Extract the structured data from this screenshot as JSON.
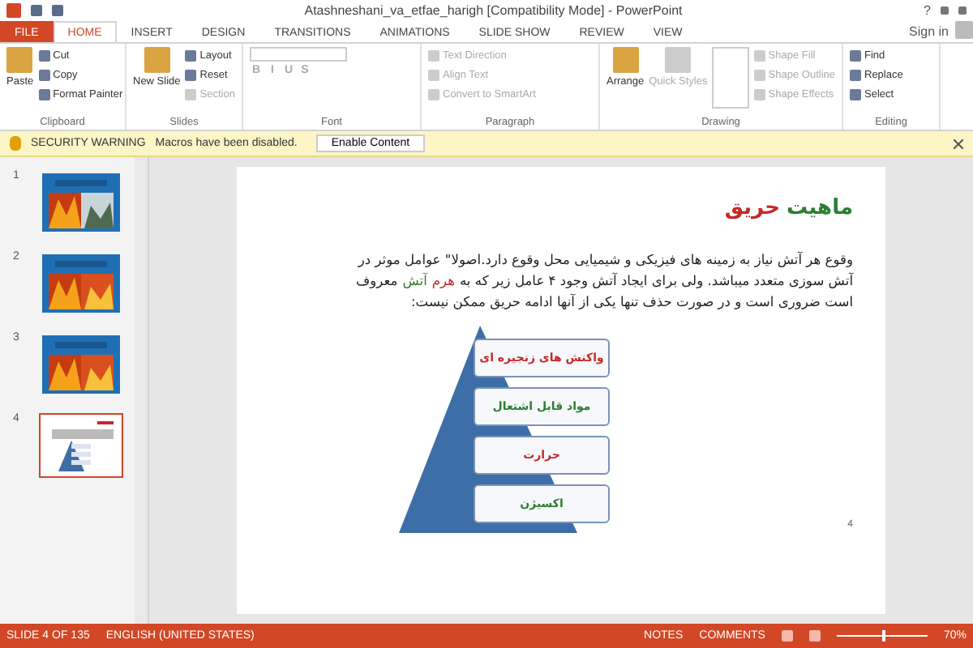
{
  "window": {
    "title": "Atashneshani_va_etfae_harigh [Compatibility Mode] - PowerPoint",
    "help": "?",
    "sign_in": "Sign in"
  },
  "tabs": [
    {
      "label": "FILE",
      "selected": false,
      "kind": "file"
    },
    {
      "label": "HOME",
      "selected": true,
      "kind": "tab"
    },
    {
      "label": "INSERT",
      "selected": false,
      "kind": "tab"
    },
    {
      "label": "DESIGN",
      "selected": false,
      "kind": "tab"
    },
    {
      "label": "TRANSITIONS",
      "selected": false,
      "kind": "tab"
    },
    {
      "label": "ANIMATIONS",
      "selected": false,
      "kind": "tab"
    },
    {
      "label": "SLIDE SHOW",
      "selected": false,
      "kind": "tab"
    },
    {
      "label": "REVIEW",
      "selected": false,
      "kind": "tab"
    },
    {
      "label": "VIEW",
      "selected": false,
      "kind": "tab"
    }
  ],
  "ribbon": {
    "groups": [
      {
        "title": "Clipboard",
        "large": {
          "label": "Paste",
          "disabled": false
        },
        "items": [
          {
            "label": "Cut",
            "disabled": false
          },
          {
            "label": "Copy",
            "disabled": false
          },
          {
            "label": "Format Painter",
            "disabled": false
          }
        ]
      },
      {
        "title": "Slides",
        "large": {
          "label": "New Slide",
          "disabled": false
        },
        "items": [
          {
            "label": "Layout",
            "disabled": false
          },
          {
            "label": "Reset",
            "disabled": false
          },
          {
            "label": "Section",
            "disabled": true
          }
        ]
      },
      {
        "title": "Font",
        "font_buttons": [
          "B",
          "I",
          "U",
          "S"
        ]
      },
      {
        "title": "Paragraph",
        "items": [
          {
            "label": "Text Direction",
            "disabled": true
          },
          {
            "label": "Align Text",
            "disabled": true
          },
          {
            "label": "Convert to SmartArt",
            "disabled": true
          }
        ]
      },
      {
        "title": "Drawing",
        "large": {
          "label": "Arrange",
          "disabled": false
        },
        "large2": {
          "label": "Quick Styles",
          "disabled": true
        },
        "items": [
          {
            "label": "Shape Fill",
            "disabled": true
          },
          {
            "label": "Shape Outline",
            "disabled": true
          },
          {
            "label": "Shape Effects",
            "disabled": true
          }
        ]
      },
      {
        "title": "Editing",
        "items": [
          {
            "label": "Find",
            "disabled": false
          },
          {
            "label": "Replace",
            "disabled": false
          },
          {
            "label": "Select",
            "disabled": false
          }
        ]
      }
    ]
  },
  "warning": {
    "title": "SECURITY WARNING",
    "message": "Macros have been disabled.",
    "button": "Enable Content"
  },
  "thumbnails": [
    {
      "number": "1",
      "selected": false,
      "kind": "picture"
    },
    {
      "number": "2",
      "selected": false,
      "kind": "picture"
    },
    {
      "number": "3",
      "selected": false,
      "kind": "picture"
    },
    {
      "number": "4",
      "selected": true,
      "kind": "mini"
    }
  ],
  "slide": {
    "title": [
      {
        "text": "ماهیت",
        "color": "#2e7d32"
      },
      {
        "text": "حریق",
        "color": "#c62828"
      }
    ],
    "lines": [
      [
        {
          "text": "وقوع هر آتش نیاز به زمینه های فیزیکی و شیمیایی محل وقوع دارد.اصولا\" عوامل موثر در",
          "color": "#222222"
        }
      ],
      [
        {
          "text": "آتش سوزی متعدد میباشد. ولی برای ایجاد آتش وجود ۴ عامل زیر که به",
          "color": "#222222"
        },
        {
          "text": "هرم",
          "color": "#c62828"
        },
        {
          "text": "آتش",
          "color": "#2e7d32"
        },
        {
          "text": "معروف",
          "color": "#222222"
        }
      ],
      [
        {
          "text": "است ضروری است و در صورت حذف تنها یکی از آنها ادامه حریق ممکن نیست:",
          "color": "#222222"
        }
      ]
    ],
    "pyramid": [
      {
        "text": "واکنش های زنجیره ای",
        "color": "#c62828"
      },
      {
        "text": "مواد قابل اشتعال",
        "color": "#2e7d32"
      },
      {
        "text": "حرارت",
        "color": "#c62828"
      },
      {
        "text": "اکسیژن",
        "color": "#2e7d32"
      }
    ],
    "number": "4"
  },
  "status_bar": {
    "slide": "SLIDE 4 OF 135",
    "language": "ENGLISH (UNITED STATES)",
    "notes": "NOTES",
    "comments": "COMMENTS",
    "zoom": "70%",
    "zoom_slider": {
      "level": 0.5
    }
  }
}
